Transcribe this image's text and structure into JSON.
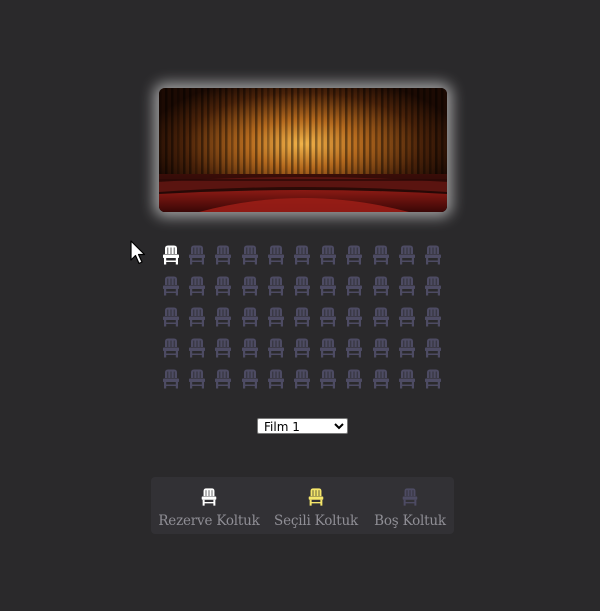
{
  "colors": {
    "background": "#2a292b",
    "seat_reserved": "#ffffff",
    "seat_selected": "#f5e66a",
    "seat_empty": "#4d4b63",
    "legend_bg": "#323135",
    "legend_text": "#8f8e95"
  },
  "screen": {
    "image": "theater-curtain-image"
  },
  "seating": {
    "rows": 5,
    "cols": 11,
    "seats": [
      [
        "reserved",
        "empty",
        "empty",
        "empty",
        "empty",
        "empty",
        "empty",
        "empty",
        "empty",
        "empty",
        "empty"
      ],
      [
        "empty",
        "empty",
        "empty",
        "empty",
        "empty",
        "empty",
        "empty",
        "empty",
        "empty",
        "empty",
        "empty"
      ],
      [
        "empty",
        "empty",
        "empty",
        "empty",
        "empty",
        "empty",
        "empty",
        "empty",
        "empty",
        "empty",
        "empty"
      ],
      [
        "empty",
        "empty",
        "empty",
        "empty",
        "empty",
        "empty",
        "empty",
        "empty",
        "empty",
        "empty",
        "empty"
      ],
      [
        "empty",
        "empty",
        "empty",
        "empty",
        "empty",
        "empty",
        "empty",
        "empty",
        "empty",
        "empty",
        "empty"
      ]
    ]
  },
  "movie_select": {
    "selected": "Film 1",
    "options": [
      "Film 1"
    ]
  },
  "legend": {
    "reserved_label": "Rezerve Koltuk",
    "selected_label": "Seçili Koltuk",
    "empty_label": "Boş Koltuk"
  },
  "icons": {
    "seat": "chair-icon",
    "cursor": "mouse-pointer-icon"
  }
}
